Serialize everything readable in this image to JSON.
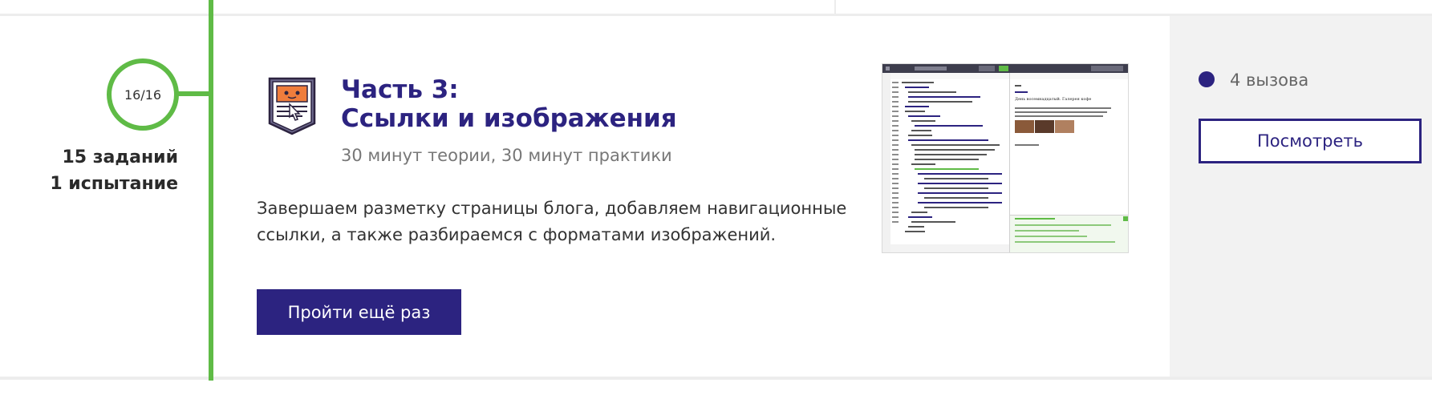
{
  "progress": {
    "text": "16/16",
    "completed": 16,
    "total": 16
  },
  "counts": {
    "tasks": "15 заданий",
    "trials": "1 испытание"
  },
  "module": {
    "icon": "document-cat-cursor-icon",
    "title_line1": "Часть 3:",
    "title_line2": "Ссылки и изображения",
    "duration": "30 минут теории, 30 минут практики",
    "description": "Завершаем разметку страницы блога, добавляем навигационные ссылки, а также разбираемся с форматами изображений.",
    "retry_label": "Пройти ещё раз"
  },
  "preview": {
    "page_heading": "День восемнадцатый. Галерея кофе"
  },
  "challenges": {
    "label": "4 вызова",
    "view_label": "Посмотреть"
  },
  "colors": {
    "accent": "#2c2380",
    "progress_green": "#5fbb46",
    "panel_gray": "#f2f2f2"
  }
}
